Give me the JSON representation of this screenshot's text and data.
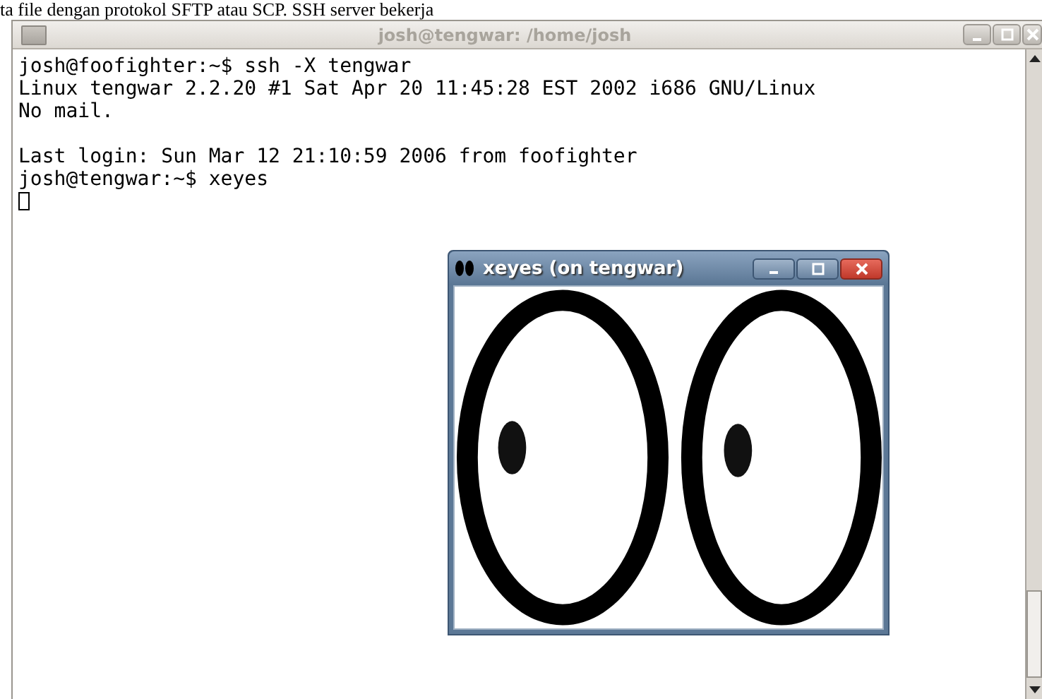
{
  "document_text": "ta file dengan protokol SFTP atau SCP. SSH server bekerja",
  "terminal": {
    "title": "josh@tengwar: /home/josh",
    "blocks": [
      [
        "josh@foofighter:~$ ssh -X tengwar",
        "Linux tengwar 2.2.20 #1 Sat Apr 20 11:45:28 EST 2002 i686 GNU/Linux",
        "No mail."
      ],
      [
        "Last login: Sun Mar 12 21:10:59 2006 from foofighter",
        "josh@tengwar:~$ xeyes"
      ]
    ],
    "cursor": true
  },
  "xeyes": {
    "title": "xeyes (on tengwar)"
  }
}
